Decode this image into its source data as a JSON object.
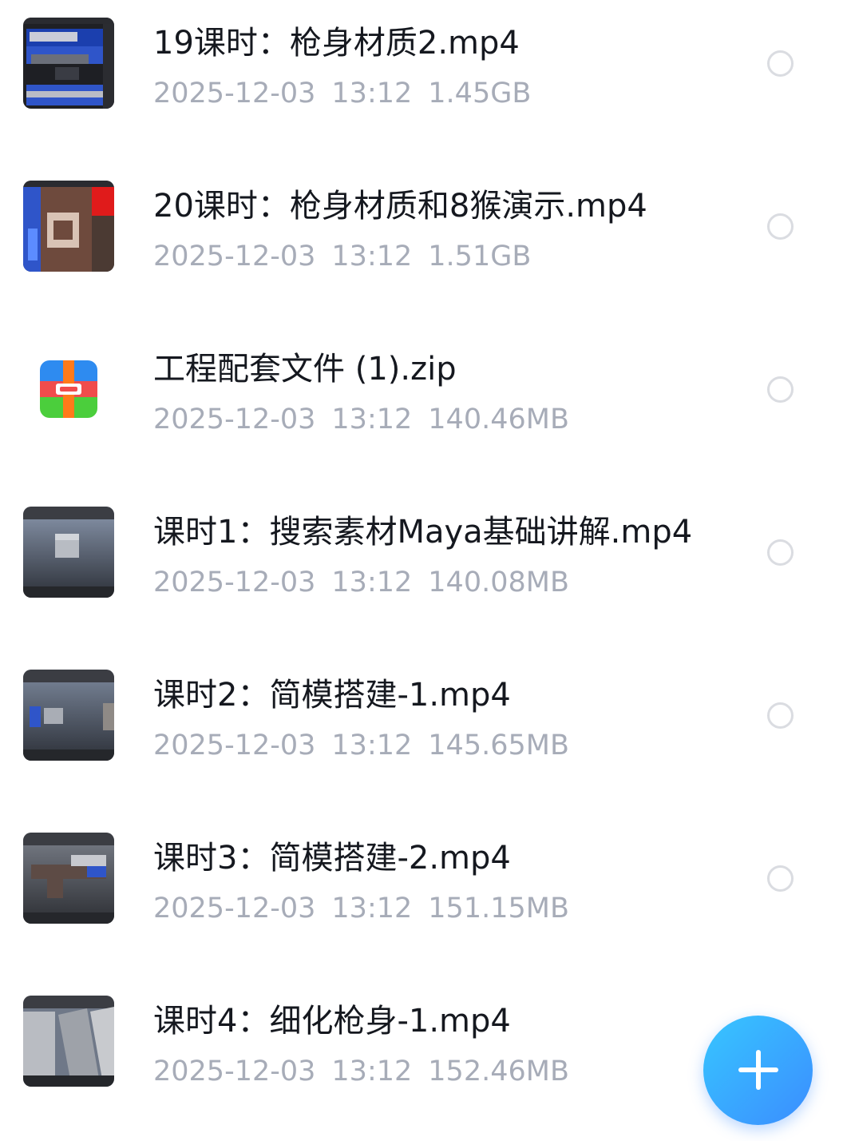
{
  "files": [
    {
      "name": "19课时：枪身材质2.mp4",
      "date": "2025-12-03",
      "time": "13:12",
      "size": "1.45GB",
      "type": "video"
    },
    {
      "name": "20课时：枪身材质和8猴演示.mp4",
      "date": "2025-12-03",
      "time": "13:12",
      "size": "1.51GB",
      "type": "video"
    },
    {
      "name": "工程配套文件 (1).zip",
      "date": "2025-12-03",
      "time": "13:12",
      "size": "140.46MB",
      "type": "zip"
    },
    {
      "name": "课时1：搜索素材Maya基础讲解.mp4",
      "date": "2025-12-03",
      "time": "13:12",
      "size": "140.08MB",
      "type": "video"
    },
    {
      "name": "课时2：简模搭建-1.mp4",
      "date": "2025-12-03",
      "time": "13:12",
      "size": "145.65MB",
      "type": "video"
    },
    {
      "name": "课时3：简模搭建-2.mp4",
      "date": "2025-12-03",
      "time": "13:12",
      "size": "151.15MB",
      "type": "video"
    },
    {
      "name": "课时4：细化枪身-1.mp4",
      "date": "2025-12-03",
      "time": "13:12",
      "size": "152.46MB",
      "type": "video"
    }
  ],
  "icons": {
    "zip": "zip-archive-icon",
    "select": "radio-unchecked-icon",
    "add": "plus-icon"
  },
  "colors": {
    "accent": "#3b8dff",
    "accent_light": "#37c6ff",
    "meta_text": "#a7acb8",
    "title_text": "#15181f"
  }
}
